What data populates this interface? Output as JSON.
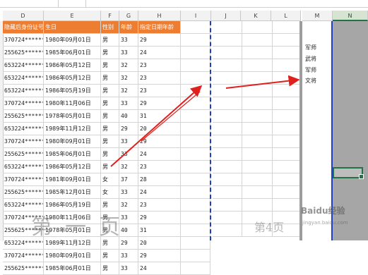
{
  "column_headers": [
    "D",
    "E",
    "F",
    "G",
    "H",
    "I",
    "J",
    "K",
    "L",
    "M",
    "N"
  ],
  "table_header": [
    "隐藏后身份证号",
    "生日",
    "性别",
    "年龄",
    "指定日期年龄"
  ],
  "rows": [
    [
      "370724******",
      "1980年09月01日",
      "男",
      "33",
      "29"
    ],
    [
      "255625******",
      "1985年06月01日",
      "男",
      "33",
      "24"
    ],
    [
      "653224******",
      "1986年05月12日",
      "男",
      "32",
      "23"
    ],
    [
      "653224******",
      "1986年05月12日",
      "男",
      "32",
      "23"
    ],
    [
      "653224******",
      "1986年05月19日",
      "男",
      "32",
      "23"
    ],
    [
      "370724******",
      "1980年11月06日",
      "男",
      "33",
      "29"
    ],
    [
      "255625******",
      "1978年05月01日",
      "男",
      "40",
      "31"
    ],
    [
      "653224******",
      "1989年11月12日",
      "男",
      "29",
      "20"
    ],
    [
      "370724******",
      "1980年09月01日",
      "男",
      "33",
      "29"
    ],
    [
      "255625******",
      "1985年06月01日",
      "男",
      "33",
      "24"
    ],
    [
      "653224******",
      "1986年05月12日",
      "男",
      "32",
      "23"
    ],
    [
      "370724******",
      "1981年09月01日",
      "女",
      "37",
      "28"
    ],
    [
      "255625******",
      "1985年12月01日",
      "女",
      "33",
      "24"
    ],
    [
      "653224******",
      "1986年05月19日",
      "男",
      "32",
      "23"
    ],
    [
      "370724******",
      "1980年11月06日",
      "男",
      "33",
      "29"
    ],
    [
      "255625******",
      "1978年05月01日",
      "男",
      "40",
      "31"
    ],
    [
      "653224******",
      "1989年11月12日",
      "男",
      "29",
      "20"
    ],
    [
      "370724******",
      "1980年09月01日",
      "男",
      "33",
      "29"
    ],
    [
      "255625******",
      "1985年06月01日",
      "男",
      "33",
      "24"
    ]
  ],
  "column_m_text": [
    "军师",
    "武将",
    "军师",
    "文将"
  ],
  "watermark_left": "第一页",
  "watermark_right": "第4页",
  "logo": "Baidu经验",
  "logo_sub": "jingyan.baidu.com",
  "colors": {
    "header_fill": "#ed7d31",
    "page_break": "#1f3fbf",
    "arrow": "#e0201d",
    "excel_green": "#217346"
  }
}
